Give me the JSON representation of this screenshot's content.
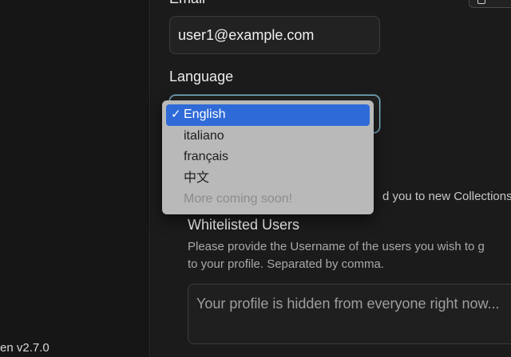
{
  "sidebar": {
    "version_text": "en v2.7.0"
  },
  "form": {
    "email_label": "Email",
    "email_value": "user1@example.com",
    "language_label": "Language",
    "language_selected": "English",
    "language_options": [
      {
        "label": "English",
        "selected": true,
        "disabled": false
      },
      {
        "label": "italiano",
        "selected": false,
        "disabled": false
      },
      {
        "label": "français",
        "selected": false,
        "disabled": false
      },
      {
        "label": "中文",
        "selected": false,
        "disabled": false
      },
      {
        "label": "More coming soon!",
        "selected": false,
        "disabled": true
      }
    ],
    "hidden_help_fragment": "d you to new Collections",
    "whitelist_title": "Whitelisted Users",
    "whitelist_help_line1": "Please provide the Username of the users you wish to g",
    "whitelist_help_line2": "to your profile. Separated by comma.",
    "whitelist_placeholder": "Your profile is hidden from everyone right now..."
  },
  "icons": {
    "check": "checkmark-icon",
    "top_button": "window-icon"
  },
  "colors": {
    "selected_option_bg": "#2f6bd8",
    "focus_border": "#8ecae6",
    "dropdown_bg": "#b9b9b9"
  }
}
